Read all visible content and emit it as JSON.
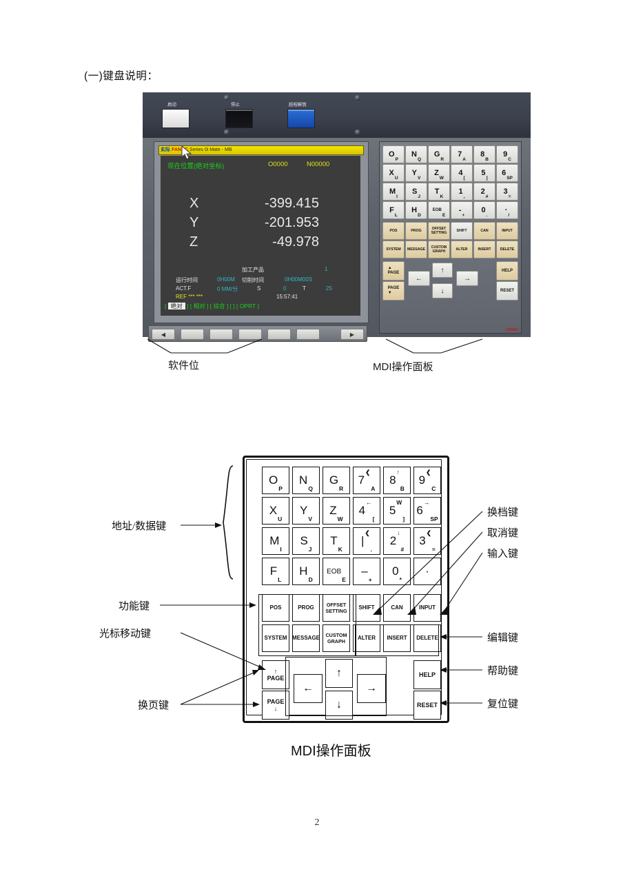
{
  "document": {
    "heading": "(一)键盘说明：",
    "page_number": "2"
  },
  "photo": {
    "top_buttons": [
      {
        "label": "启动",
        "color": "#fdfdfd"
      },
      {
        "label": "停止",
        "color": "#0c0d10"
      },
      {
        "label": "超程解放",
        "color": "#2a6fd6"
      }
    ],
    "cnc": {
      "title_bar": {
        "prefix": "实际",
        "brand": "FANUC",
        "model": "Series 0i Mate - MB"
      },
      "header_left": "现在位置(绝对坐标)",
      "header_o": "O0000",
      "header_n": "N00000",
      "axes": [
        {
          "name": "X",
          "value": "-399.415"
        },
        {
          "name": "Y",
          "value": "-201.953"
        },
        {
          "name": "Z",
          "value": "-49.978"
        }
      ],
      "status": {
        "parts_label": "加工产品",
        "parts_value": "1",
        "runtime_label": "运行时间",
        "runtime_value": "0H00M",
        "cut_label": "切削时间",
        "cut_value": "0H00M00S",
        "actf_label": "ACT.F",
        "actf_value": "0 MM/分",
        "s_label": "S",
        "s_value": "0",
        "t_label": "T",
        "t_value": "25",
        "mode": "REF *** ***",
        "clock": "15:57:41"
      },
      "soft_labels": [
        {
          "text": "绝对",
          "active": true
        },
        {
          "text": "相对",
          "active": false
        },
        {
          "text": "综合",
          "active": false
        },
        {
          "text": "",
          "active": false
        },
        {
          "text": "OPRT",
          "active": false
        }
      ]
    },
    "mdi_keys_rows": [
      [
        "O|P",
        "N|Q",
        "G|R",
        "7|A",
        "8|B",
        "9|C"
      ],
      [
        "X|U",
        "Y|V",
        "Z|W",
        "4|[",
        "5|]",
        "6|SP"
      ],
      [
        "M|I",
        "S|J",
        "T|K",
        "1|,",
        "2|#",
        "3|="
      ],
      [
        "F|L",
        "H|D",
        "EOB|E",
        "-|+",
        "0|.",
        "·|/"
      ]
    ],
    "mdi_function_rows": [
      [
        "POS",
        "PROG",
        "OFFSET SETTING",
        "SHIFT",
        "CAN",
        "INPUT"
      ],
      [
        "SYSTEM",
        "MESSAGE",
        "CUSTOM GRAPH",
        "ALTER",
        "INSERT",
        "DELETE"
      ]
    ],
    "mdi_nav": {
      "page_up": "PAGE",
      "page_down": "PAGE",
      "help": "HELP",
      "reset": "RESET"
    },
    "brand_mark": "FANUC",
    "softkey_arrows": {
      "left": "◀",
      "right": "▶"
    },
    "captions": [
      {
        "text": "软件位"
      },
      {
        "text": "MDI操作面板"
      }
    ]
  },
  "diagram": {
    "address_rows": [
      [
        {
          "main": "O",
          "sub": "P"
        },
        {
          "main": "N",
          "sub": "Q"
        },
        {
          "main": "G",
          "sub": "R"
        },
        {
          "main": "7",
          "sub": "A",
          "glyph": "stroke"
        },
        {
          "main": "8",
          "sub": "B",
          "glyph": "up"
        },
        {
          "main": "9",
          "sub": "C",
          "glyph": "stroke"
        }
      ],
      [
        {
          "main": "X",
          "sub": "U"
        },
        {
          "main": "Y",
          "sub": "V"
        },
        {
          "main": "Z",
          "sub": "W"
        },
        {
          "main": "4",
          "sub": "[",
          "glyph": "left"
        },
        {
          "main": "5",
          "sub": "]",
          "glyph": "w"
        },
        {
          "main": "6",
          "sub": "SP",
          "glyph": "right"
        }
      ],
      [
        {
          "main": "M",
          "sub": "I"
        },
        {
          "main": "S",
          "sub": "J"
        },
        {
          "main": "T",
          "sub": "K"
        },
        {
          "main": "|",
          "sub": ".",
          "glyph": "stroke"
        },
        {
          "main": "2",
          "sub": "#",
          "glyph": "down"
        },
        {
          "main": "3",
          "sub": "=",
          "glyph": "stroke"
        }
      ],
      [
        {
          "main": "F",
          "sub": "L"
        },
        {
          "main": "H",
          "sub": "D"
        },
        {
          "main": "EOB",
          "sub": "E"
        },
        {
          "main": "–",
          "sub": "+"
        },
        {
          "main": "0",
          "sub": "*"
        },
        {
          "main": "·",
          "sub": ""
        }
      ]
    ],
    "function_rows": [
      [
        "POS",
        "PROG",
        "OFFSET SETTING",
        "SHIFT",
        "CAN",
        "INPUT"
      ],
      [
        "SYSTEM",
        "MESSAGE",
        "CUSTOM GRAPH",
        "ALTER",
        "INSERT",
        "DELETE"
      ]
    ],
    "nav": {
      "page_up": "PAGE",
      "page_down": "PAGE",
      "help": "HELP",
      "reset": "RESET",
      "cursor_up": "↑",
      "cursor_down": "↓",
      "cursor_left": "←",
      "cursor_right": "→"
    },
    "labels_left": [
      "地址/数据键",
      "功能键",
      "光标移动键",
      "换页键"
    ],
    "labels_right": [
      "换档键",
      "取消键",
      "输入键",
      "编辑键",
      "帮助键",
      "复位键"
    ],
    "caption": "MDI操作面板"
  }
}
